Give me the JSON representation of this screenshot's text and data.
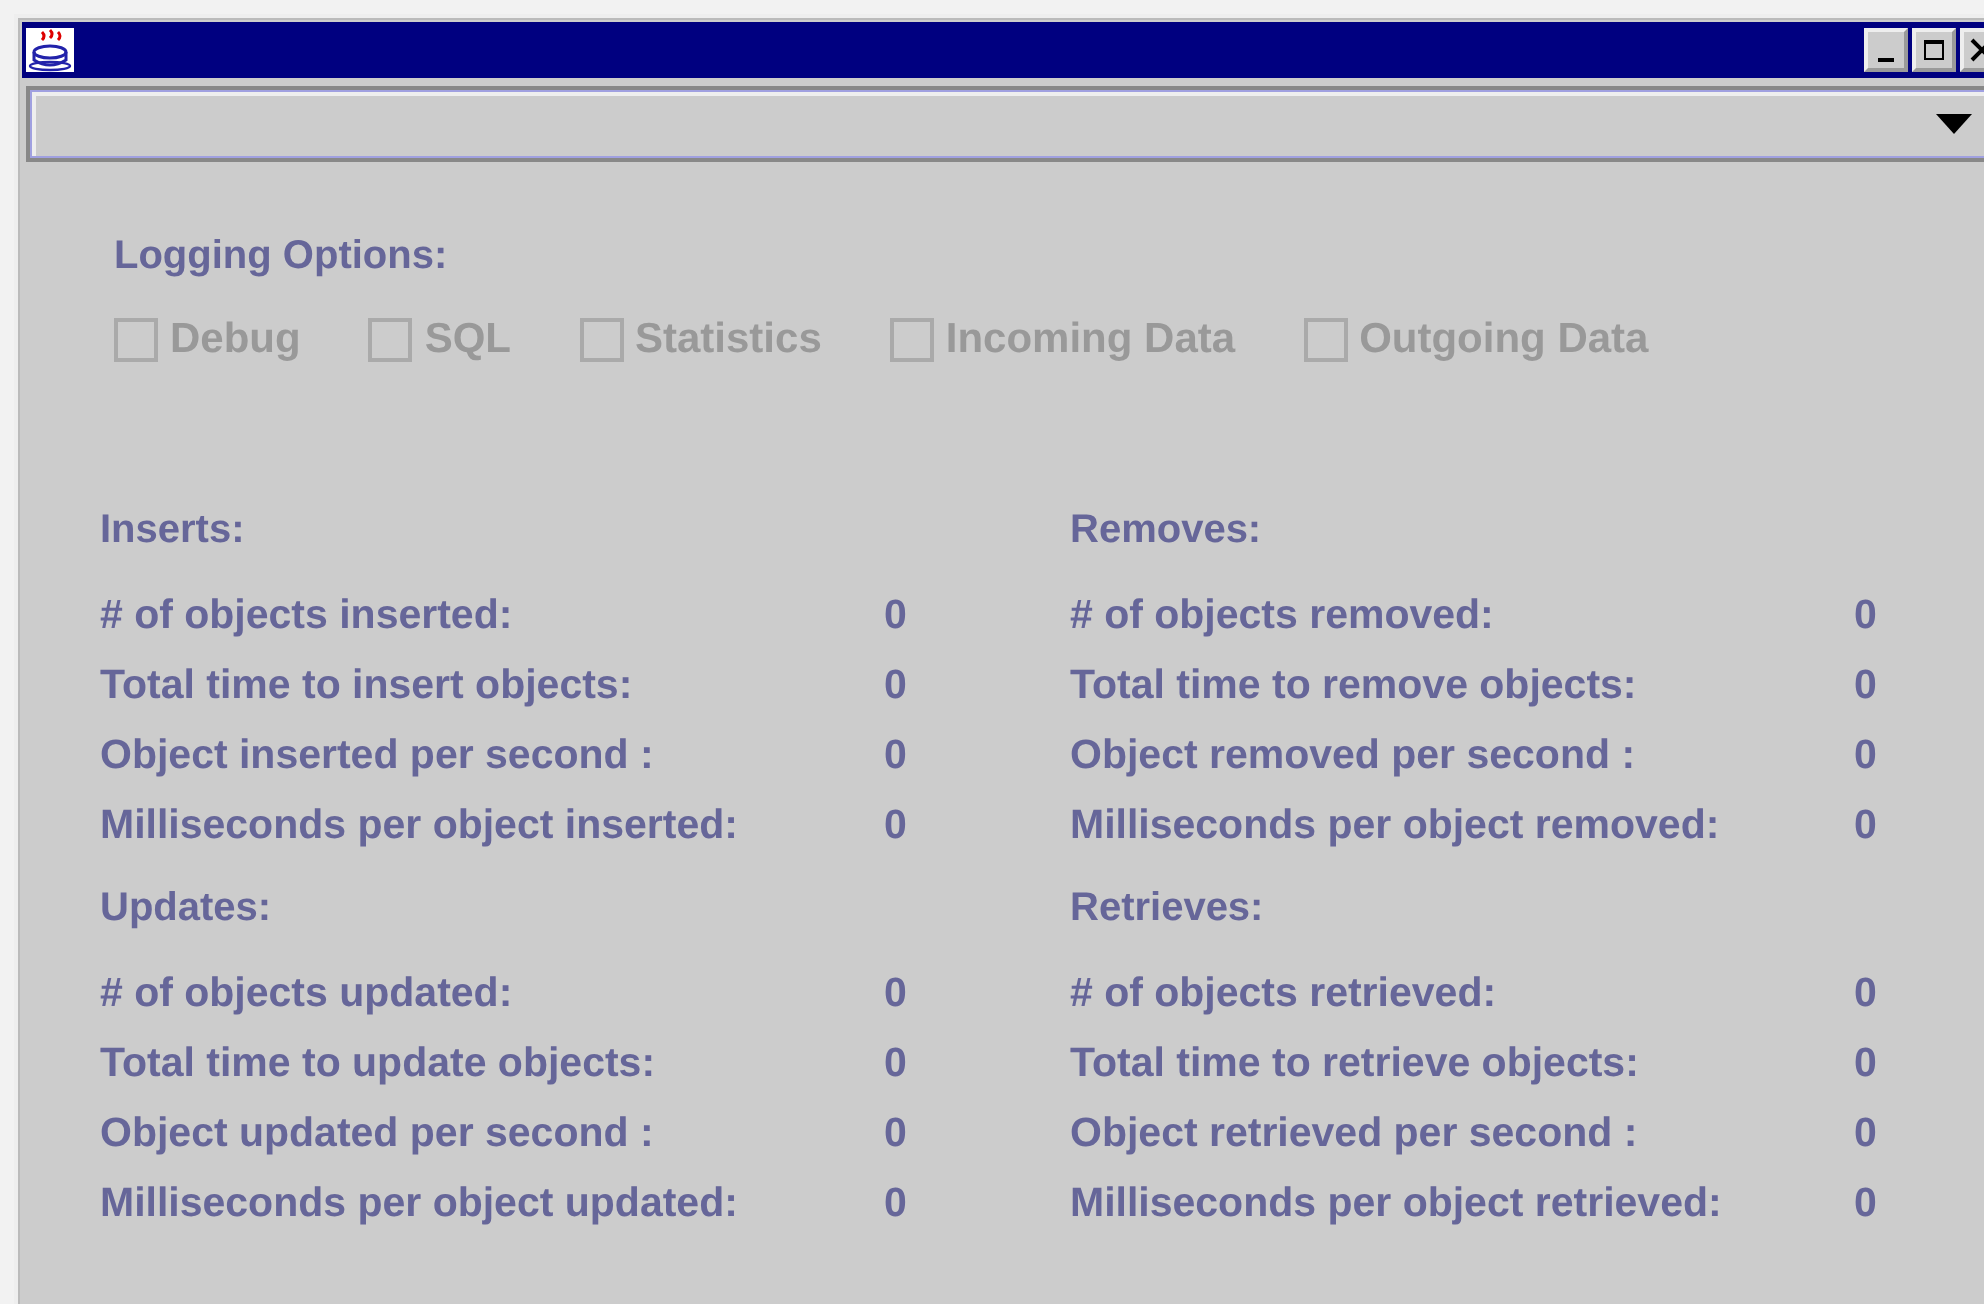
{
  "logging": {
    "label": "Logging Options:",
    "options": [
      {
        "label": "Debug",
        "checked": false,
        "disabled": true
      },
      {
        "label": "SQL",
        "checked": false,
        "disabled": true
      },
      {
        "label": "Statistics",
        "checked": false,
        "disabled": true
      },
      {
        "label": "Incoming Data",
        "checked": false,
        "disabled": true
      },
      {
        "label": "Outgoing Data",
        "checked": false,
        "disabled": true
      }
    ]
  },
  "sections": [
    {
      "title": "Inserts:",
      "rows": [
        {
          "label": "# of objects inserted:",
          "value": "0"
        },
        {
          "label": "Total time to insert objects:",
          "value": "0"
        },
        {
          "label": "Object inserted per second :",
          "value": "0"
        },
        {
          "label": "Milliseconds per object inserted:",
          "value": "0"
        }
      ]
    },
    {
      "title": "Removes:",
      "rows": [
        {
          "label": "# of objects removed:",
          "value": "0"
        },
        {
          "label": "Total time to remove objects:",
          "value": "0"
        },
        {
          "label": "Object removed per second :",
          "value": "0"
        },
        {
          "label": "Milliseconds per object removed:",
          "value": "0"
        }
      ]
    },
    {
      "title": "Updates:",
      "rows": [
        {
          "label": "# of objects updated:",
          "value": "0"
        },
        {
          "label": "Total time to update objects:",
          "value": "0"
        },
        {
          "label": "Object updated per second :",
          "value": "0"
        },
        {
          "label": "Milliseconds per object updated:",
          "value": "0"
        }
      ]
    },
    {
      "title": "Retrieves:",
      "rows": [
        {
          "label": "# of objects retrieved:",
          "value": "0"
        },
        {
          "label": "Total time to retrieve objects:",
          "value": "0"
        },
        {
          "label": "Object retrieved per second :",
          "value": "0"
        },
        {
          "label": "Milliseconds per object retrieved:",
          "value": "0"
        }
      ]
    }
  ]
}
